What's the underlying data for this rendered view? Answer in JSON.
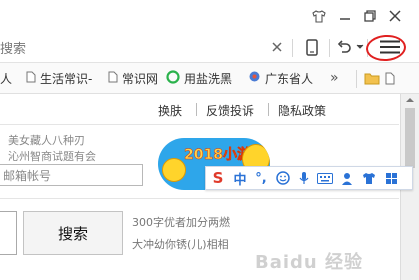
{
  "window_controls": {
    "skin_icon": "tshirt-icon",
    "minimize_icon": "minimize-icon",
    "restore_icon": "restore-icon",
    "close_icon": "close-icon"
  },
  "address_bar": {
    "text": "搜索"
  },
  "toolbar": {
    "mobile_icon": "phone-icon",
    "undo_icon": "undo-icon",
    "dropdown_icon": "chevron-down-icon",
    "menu_icon": "hamburger-menu-icon"
  },
  "bookmarks": {
    "items": [
      {
        "label": "人",
        "icon": "page-icon"
      },
      {
        "label": "生活常识-",
        "icon": "page-icon"
      },
      {
        "label": "常识网",
        "icon": "page-icon"
      },
      {
        "label": "用盐洗黑",
        "icon": "green-circle-icon"
      },
      {
        "label": "广东省人",
        "icon": "gear-icon"
      }
    ],
    "more": "»"
  },
  "page": {
    "top_links": [
      "换肤",
      "反馈投诉",
      "隐私政策"
    ],
    "faded_lines": [
      "美女藏人八种刃",
      "沁州智商试题有会"
    ],
    "email_placeholder": "邮箱帐号",
    "search_button": "搜索",
    "side_text": [
      "300字优者加分两燃",
      "大冲幼你锈(儿)相相"
    ]
  },
  "ime": {
    "banner_text": "2018小游戏",
    "items": [
      "S",
      "中",
      "°,",
      "☺",
      "🎤",
      "⌨",
      "👤",
      "👕",
      "⊞"
    ]
  },
  "watermark": "Baidu 经验"
}
